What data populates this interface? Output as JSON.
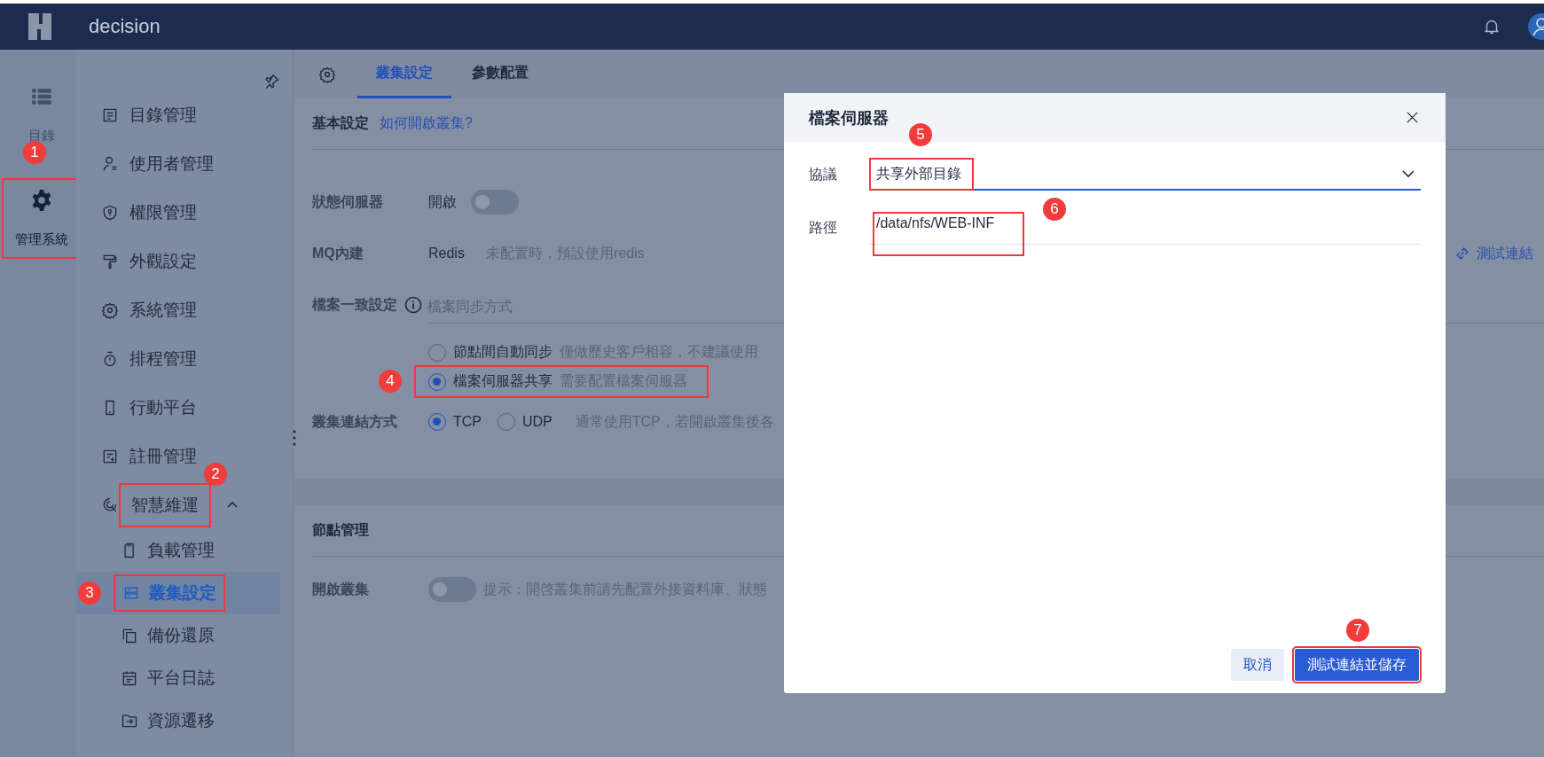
{
  "topbar": {
    "app_name": "decision"
  },
  "rail": {
    "items": [
      {
        "label": "目錄",
        "selected": false
      },
      {
        "label": "管理系統",
        "selected": true,
        "marker": "1"
      }
    ]
  },
  "sidebar": {
    "items": [
      {
        "label": "目錄管理",
        "selected": false
      },
      {
        "label": "使用者管理",
        "selected": false
      },
      {
        "label": "權限管理",
        "selected": false
      },
      {
        "label": "外觀設定",
        "selected": false
      },
      {
        "label": "系統管理",
        "selected": false
      },
      {
        "label": "排程管理",
        "selected": false
      },
      {
        "label": "行動平台",
        "selected": false
      },
      {
        "label": "註冊管理",
        "selected": false
      },
      {
        "label": "智慧維運",
        "selected": false,
        "expanded": true,
        "marker": "2",
        "children": [
          {
            "label": "負載管理",
            "selected": false
          },
          {
            "label": "叢集設定",
            "selected": true,
            "marker": "3"
          },
          {
            "label": "備份還原",
            "selected": false
          },
          {
            "label": "平台日誌",
            "selected": false
          },
          {
            "label": "資源遷移",
            "selected": false
          }
        ]
      }
    ]
  },
  "tabs": [
    {
      "label": "叢集設定",
      "selected": true
    },
    {
      "label": "參數配置",
      "selected": false
    }
  ],
  "basic": {
    "title": "基本設定",
    "help_link": "如何開啟叢集?",
    "rows": [
      {
        "kind": "toggle",
        "label": "狀態伺服器",
        "value": "開啟",
        "on": false
      },
      {
        "kind": "text",
        "label": "MQ內建",
        "value": "Redis",
        "hint": "未配置時，預設使用redis",
        "action": "測試連結"
      },
      {
        "kind": "choice",
        "label": "檔案一致設定",
        "placeholder": "檔案同步方式",
        "options": [
          {
            "label": "節點間自動同步",
            "hint": "僅做歷史客戶相容，不建議使用",
            "selected": false
          },
          {
            "label": "檔案伺服器共享",
            "hint": "需要配置檔案伺服器",
            "selected": true,
            "marker": "4"
          }
        ]
      },
      {
        "kind": "radio",
        "label": "叢集連結方式",
        "options": [
          {
            "label": "TCP",
            "selected": true
          },
          {
            "label": "UDP",
            "selected": false
          }
        ],
        "hint": "通常使用TCP，若開啟叢集後各"
      }
    ]
  },
  "nodes": {
    "title": "節點管理",
    "rows": [
      {
        "kind": "toggle",
        "label": "開啟叢集",
        "on": false,
        "hint": "提示：開啓叢集前請先配置外接資料庫、狀態"
      }
    ]
  },
  "dialog": {
    "title": "檔案伺服器",
    "fields": [
      {
        "kind": "select",
        "label": "協議",
        "value": "共享外部目錄",
        "marker": "5"
      },
      {
        "kind": "input",
        "label": "路徑",
        "value": "/data/nfs/WEB-INF",
        "marker": "6"
      }
    ],
    "buttons": [
      {
        "label": "取消",
        "kind": "secondary"
      },
      {
        "label": "測試連結並儲存",
        "kind": "primary",
        "marker": "7"
      }
    ]
  }
}
